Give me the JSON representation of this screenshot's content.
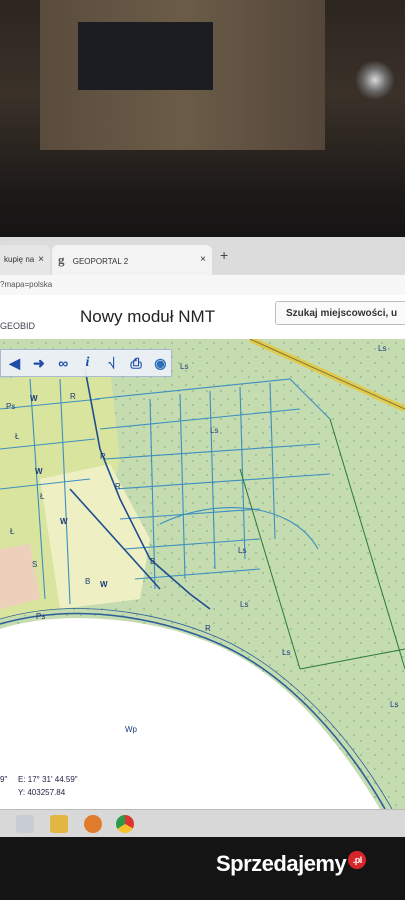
{
  "browser": {
    "tabs": [
      {
        "label": "kupię na"
      },
      {
        "label": "GEOPORTAL 2"
      }
    ],
    "close_glyph": "×",
    "new_tab_glyph": "+",
    "url_fragment": "?mapa=polska"
  },
  "app": {
    "logo_text": "GEOBID",
    "title": "Nowy moduł NMT",
    "search_text": "Szukaj miejscowości, u"
  },
  "map": {
    "toolbar_icons": [
      "arrow-left-icon",
      "arrow-right-icon",
      "link-icon",
      "info-icon",
      "measure-icon",
      "print-icon",
      "globe-icon"
    ],
    "labels": {
      "lake": "Wp",
      "ls": "Ls",
      "ps": "Ps",
      "w": "W",
      "r": "R",
      "l": "Ł",
      "b": "B",
      "s": "S"
    },
    "coordinates": {
      "lat_fragment": "9\"",
      "lon": "E: 17° 31' 44.59\"",
      "y_value": "Y: 403257.84"
    },
    "colors": {
      "parcel_lines": "#2f7fb5",
      "forest_fill": "#bcd8a7",
      "agri_fill": "#e3e7a4",
      "lake_fill": "#ffffff",
      "road": "#e8d24a"
    }
  },
  "watermark": {
    "text": "Sprzedajemy",
    "badge": ".pl"
  }
}
